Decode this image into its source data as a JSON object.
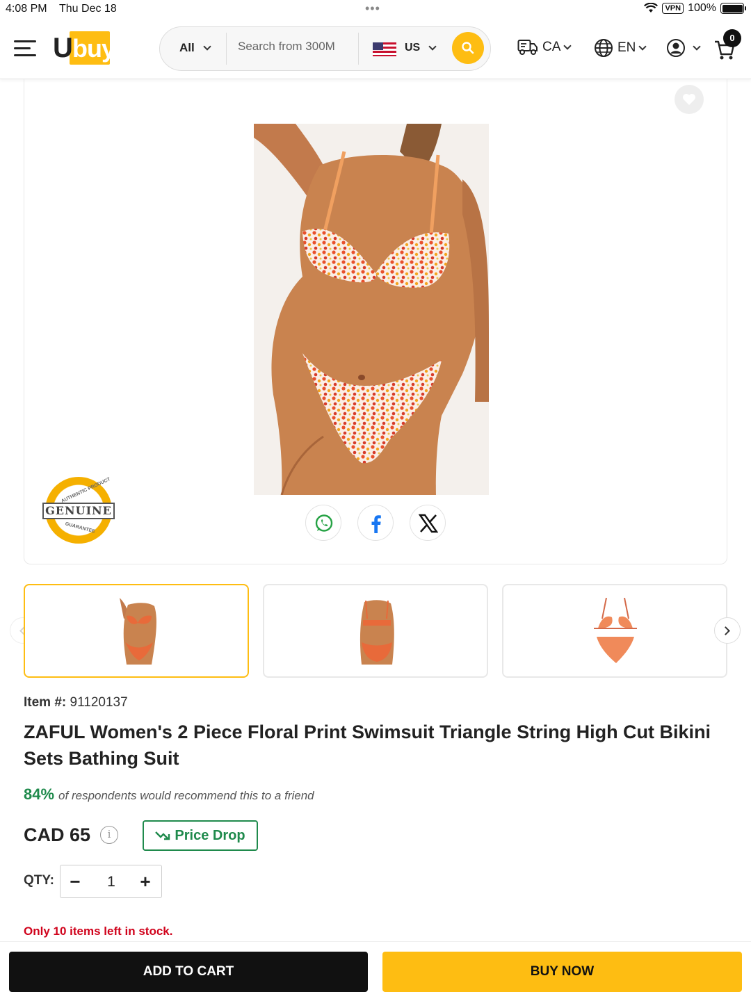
{
  "status_bar": {
    "time": "4:08 PM",
    "date": "Thu Dec 18",
    "vpn": "VPN",
    "battery": "100%"
  },
  "header": {
    "logo_u": "U",
    "logo_buy": "buy",
    "search": {
      "category": "All",
      "placeholder": "Search from 300M",
      "country": "US"
    },
    "ship_to": "CA",
    "language": "EN",
    "cart_count": "0"
  },
  "product": {
    "badge_text": "GENUINE",
    "badge_top": "AUTHENTIC PRODUCT",
    "badge_bottom": "GUARANTEE",
    "item_label": "Item #:",
    "item_number": "91120137",
    "title": "ZAFUL Women's 2 Piece Floral Print Swimsuit Triangle String High Cut Bikini Sets Bathing Suit",
    "recommend_pct": "84%",
    "recommend_text": "of respondents would recommend this to a friend",
    "price": "CAD 65",
    "price_drop_label": "Price Drop",
    "qty_label": "QTY:",
    "qty_value": "1",
    "stock_text": "Only 10 items left in stock."
  },
  "actions": {
    "add_to_cart": "ADD TO CART",
    "buy_now": "BUY NOW"
  },
  "colors": {
    "accent": "#febd12",
    "green": "#1f8a4c",
    "stock_red": "#d0021b"
  }
}
